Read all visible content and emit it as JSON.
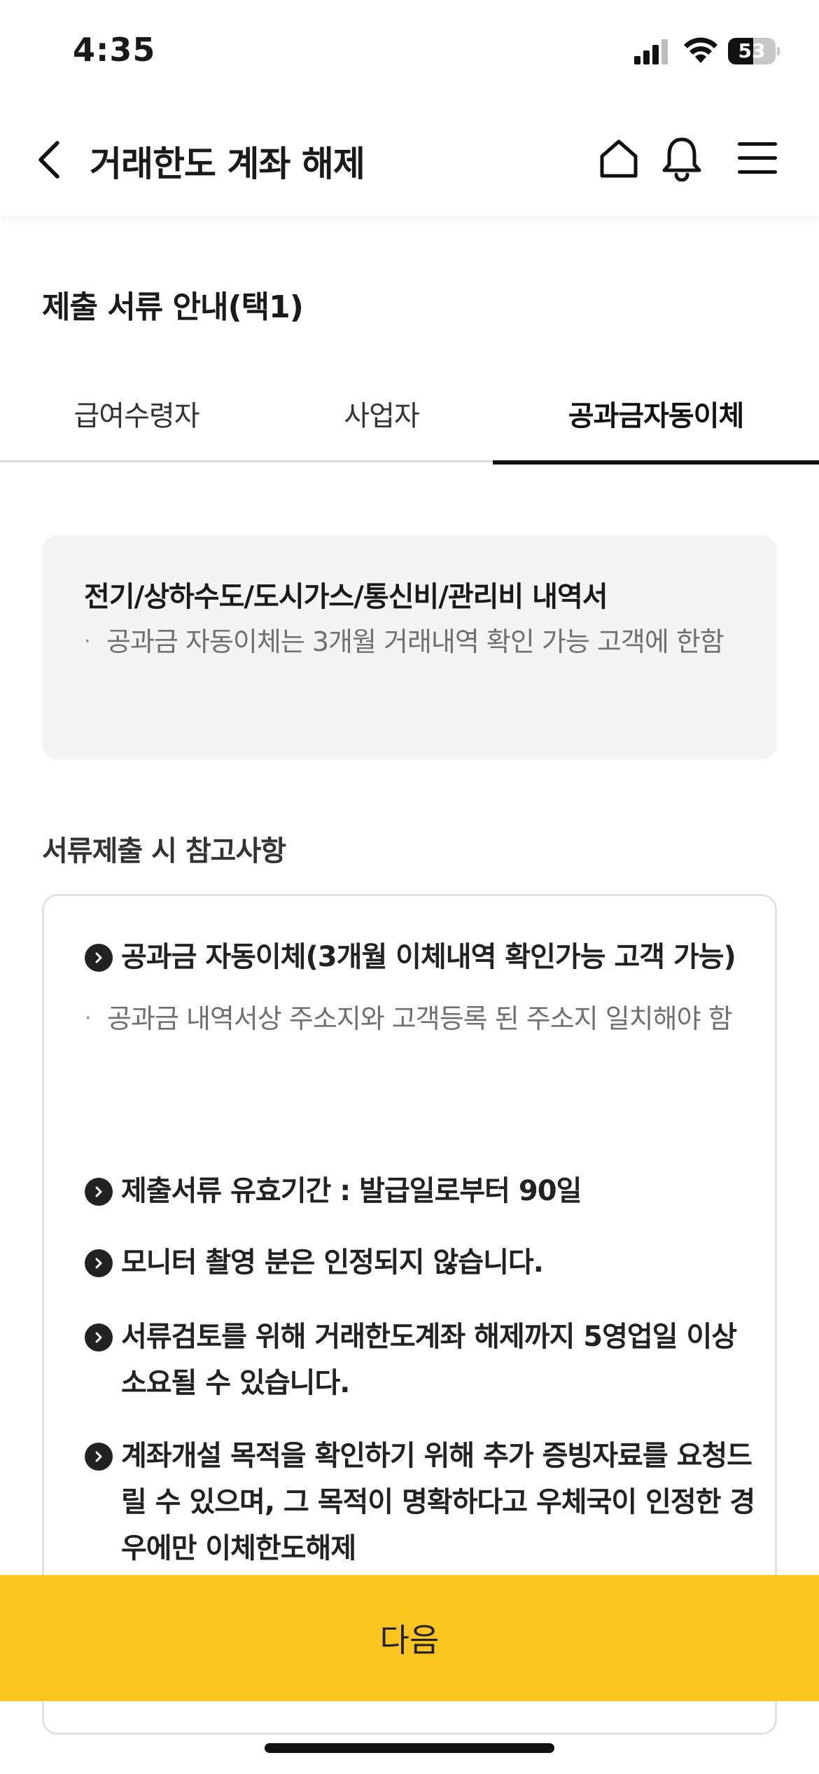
{
  "status_bar": {
    "time": "4:35",
    "battery": "53",
    "battery_level": 0.53
  },
  "header": {
    "title": "거래한도 계좌 해제"
  },
  "section": {
    "title": "제출 서류 안내(택1)"
  },
  "tabs": [
    {
      "label": "급여수령자",
      "active": false
    },
    {
      "label": "사업자",
      "active": false
    },
    {
      "label": "공과금자동이체",
      "active": true
    }
  ],
  "info": {
    "title": "전기/상하수도/도시가스/통신비/관리비 내역서",
    "bullet": "공과금 자동이체는 3개월 거래내역 확인 가능 고객에 한함"
  },
  "notes": {
    "title": "서류제출 시 참고사항",
    "items": [
      {
        "text": "공과금 자동이체(3개월 이체내역 확인가능 고객 가능)",
        "sub": "공과금 내역서상 주소지와 고객등록 된 주소지 일치해야 함"
      },
      {
        "text": "제출서류 유효기간 : 발급일로부터 90일"
      },
      {
        "text": "모니터 촬영 분은 인정되지 않습니다."
      },
      {
        "text": "서류검토를 위해 거래한도계좌 해제까지 5영업일 이상 소요될 수 있습니다."
      },
      {
        "text": "계좌개설 목적을 확인하기 위해 추가 증빙자료를 요청드릴 수 있으며, 그 목적이 명확하다고 우체국이 인정한 경우에만 이체한도해제"
      }
    ]
  },
  "footer": {
    "next_label": "다음"
  }
}
